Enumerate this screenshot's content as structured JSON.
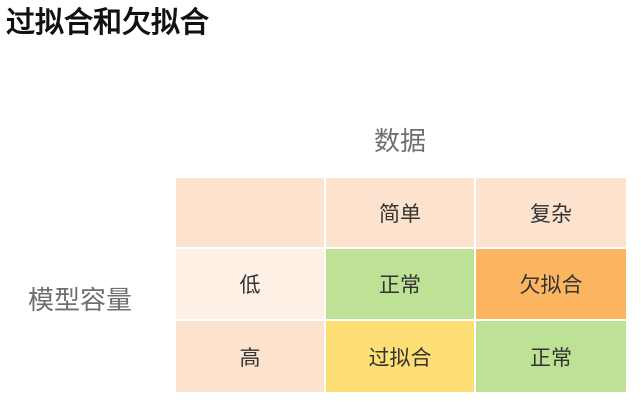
{
  "title": "过拟合和欠拟合",
  "axes": {
    "columns_label": "数据",
    "rows_label": "模型容量"
  },
  "matrix": {
    "corner": {
      "text": "",
      "color": "#fde3cd"
    },
    "column_headers": [
      {
        "text": "简单",
        "color": "#fde3cd"
      },
      {
        "text": "复杂",
        "color": "#fde3cd"
      }
    ],
    "rows": [
      {
        "header": {
          "text": "低",
          "color": "#fef0e5"
        },
        "cells": [
          {
            "text": "正常",
            "color": "#bde296"
          },
          {
            "text": "欠拟合",
            "color": "#fbb560"
          }
        ]
      },
      {
        "header": {
          "text": "高",
          "color": "#fde3cd"
        },
        "cells": [
          {
            "text": "过拟合",
            "color": "#fddf75"
          },
          {
            "text": "正常",
            "color": "#bde296"
          }
        ]
      }
    ]
  }
}
